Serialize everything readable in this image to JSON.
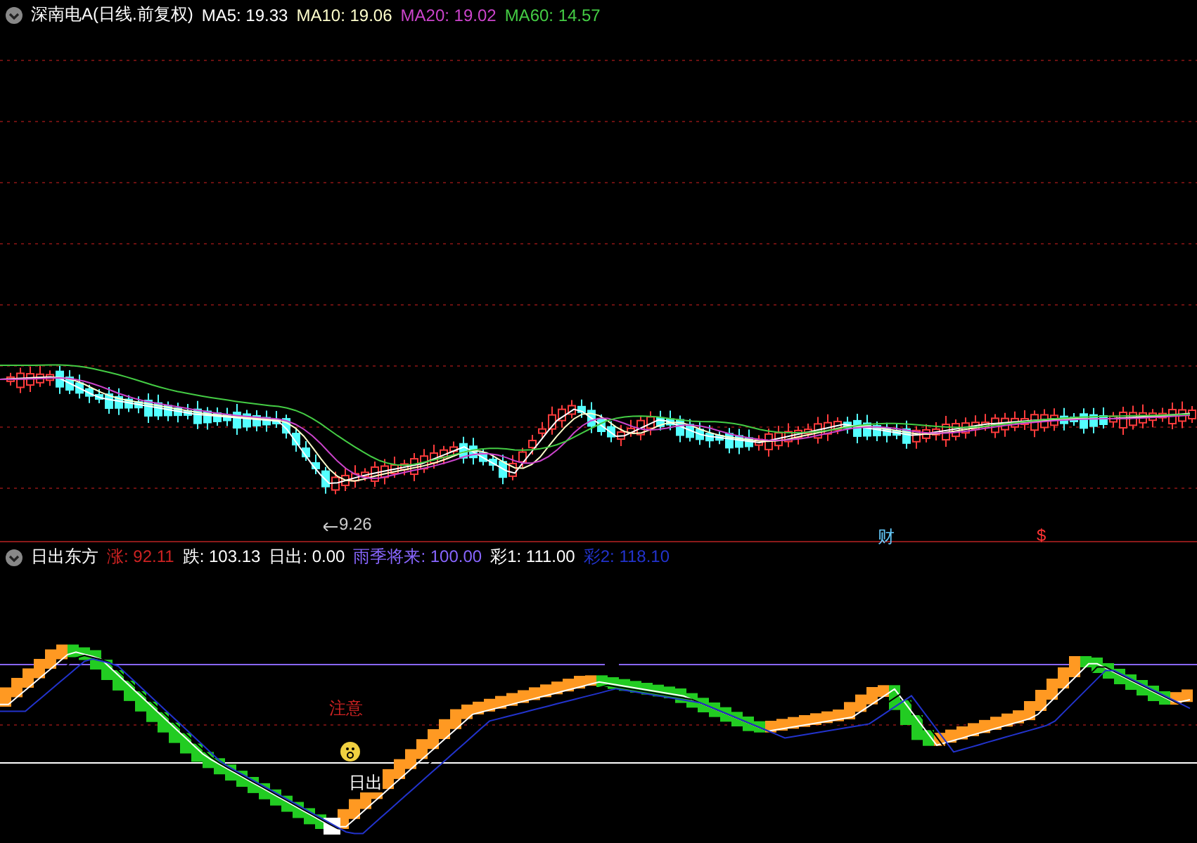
{
  "price_panel": {
    "title": "深南电A(日线.前复权)",
    "legend": [
      {
        "label": "MA5: 19.33",
        "color": "#ffffff"
      },
      {
        "label": "MA10: 19.06",
        "color": "#ffffcc"
      },
      {
        "label": "MA20: 19.02",
        "color": "#cc44cc"
      },
      {
        "label": "MA60: 14.57",
        "color": "#44cc44"
      }
    ],
    "low_marker": "9.26",
    "event_markers": [
      {
        "label": "财",
        "color": "#66ccff"
      },
      {
        "label": "$",
        "color": "#ff3333"
      }
    ]
  },
  "indicator_panel": {
    "title": "日出东方",
    "legend": [
      {
        "label": "涨: 92.11",
        "color": "#cc2222"
      },
      {
        "label": "跌: 103.13",
        "color": "#ffffff"
      },
      {
        "label": "日出: 0.00",
        "color": "#ffffff"
      },
      {
        "label": "雨季将来: 100.00",
        "color": "#8866ff"
      },
      {
        "label": "彩1: 111.00",
        "color": "#ffffff"
      },
      {
        "label": "彩2: 118.10",
        "color": "#2233cc"
      }
    ],
    "labels": [
      {
        "text": "注意",
        "color": "#cc2222"
      },
      {
        "text": "日出",
        "color": "#ffffff"
      }
    ]
  }
}
